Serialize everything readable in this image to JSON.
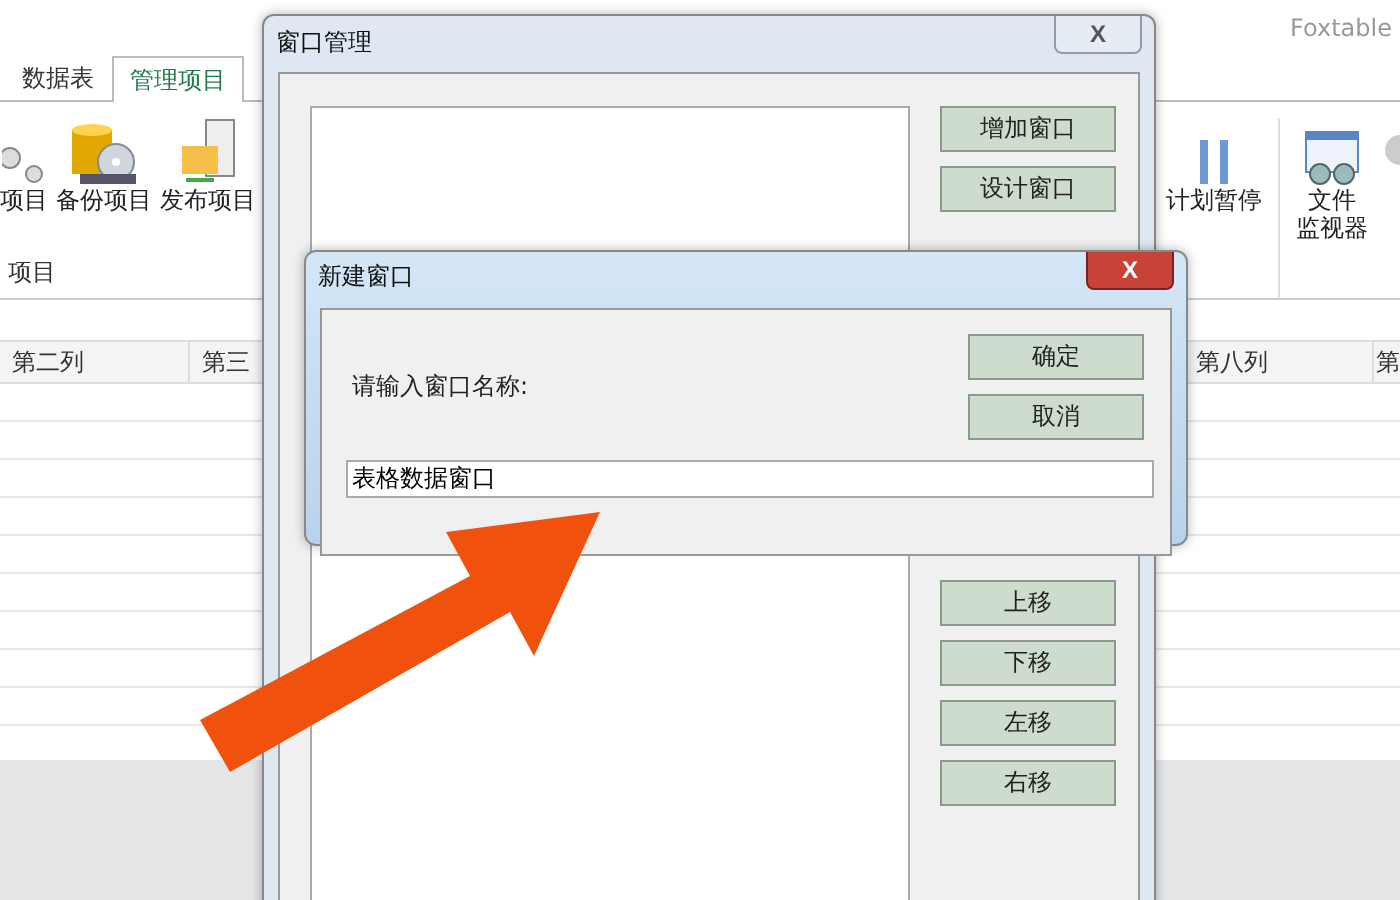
{
  "app": {
    "title": "Foxtable",
    "tabs": [
      {
        "label": "数据表",
        "selected": false
      },
      {
        "label": "管理项目",
        "selected": true
      }
    ],
    "ribbon_left": {
      "items": [
        {
          "lines": [
            "项目"
          ],
          "kind": "person"
        },
        {
          "lines": [
            "备份项目"
          ],
          "kind": "database"
        },
        {
          "lines": [
            "发布项目"
          ],
          "kind": "folder"
        }
      ],
      "group": "项目"
    },
    "ribbon_right": {
      "items": [
        {
          "lines": [
            "计划暂停"
          ],
          "kind": "pause"
        },
        {
          "lines": [
            "文件",
            "监视器"
          ],
          "kind": "monitor"
        },
        {
          "kind": "partial"
        }
      ]
    },
    "columns_left": [
      "第二列",
      "第三"
    ],
    "columns_right": [
      "第八列",
      "第"
    ]
  },
  "manager": {
    "title": "窗口管理",
    "close": "X",
    "buttons_top": [
      "增加窗口",
      "设计窗口"
    ],
    "buttons_bottom": [
      "上移",
      "下移",
      "左移",
      "右移"
    ]
  },
  "dialog": {
    "title": "新建窗口",
    "close": "X",
    "prompt": "请输入窗口名称:",
    "value": "表格数据窗口",
    "buttons": [
      "确定",
      "取消"
    ]
  }
}
